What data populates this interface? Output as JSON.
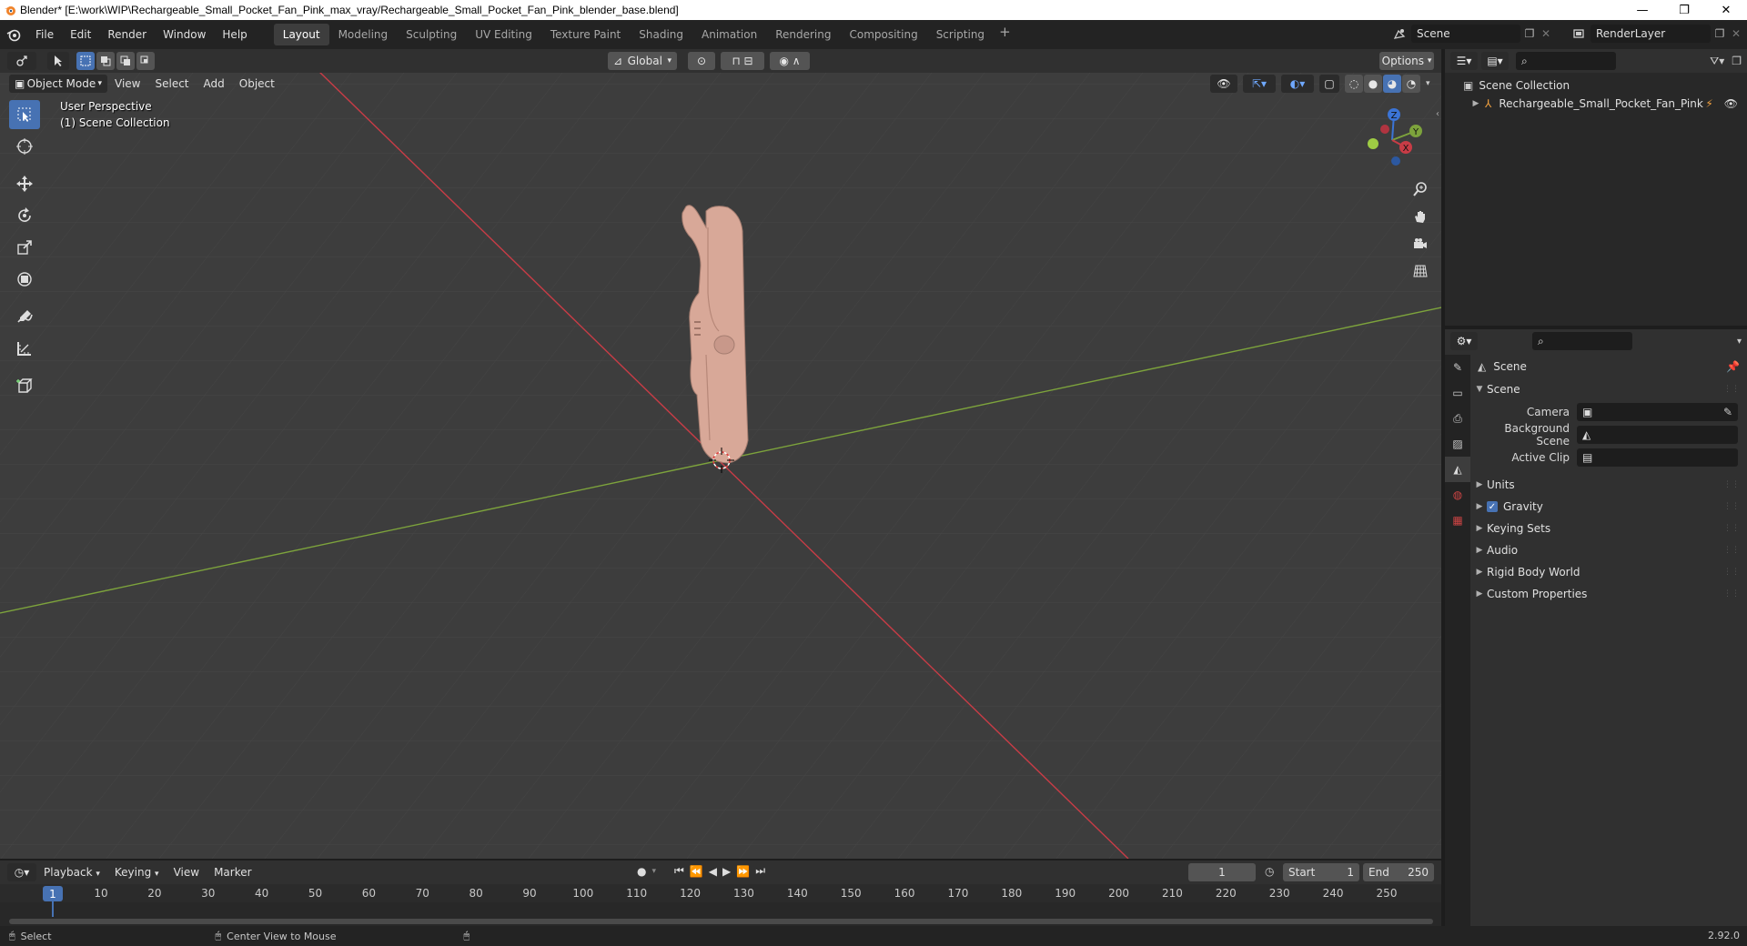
{
  "window": {
    "title": "Blender* [E:\\work\\WIP\\Rechargeable_Small_Pocket_Fan_Pink_max_vray/Rechargeable_Small_Pocket_Fan_Pink_blender_base.blend]",
    "minimize": "—",
    "restore": "❐",
    "close": "✕"
  },
  "menu": [
    "File",
    "Edit",
    "Render",
    "Window",
    "Help"
  ],
  "workspaces": [
    "Layout",
    "Modeling",
    "Sculpting",
    "UV Editing",
    "Texture Paint",
    "Shading",
    "Animation",
    "Rendering",
    "Compositing",
    "Scripting"
  ],
  "active_workspace": "Layout",
  "scene_selector": "Scene",
  "renderlayer_selector": "RenderLayer",
  "viewport": {
    "transform_orientation": "Global",
    "options_label": "Options",
    "mode": "Object Mode",
    "menus": [
      "View",
      "Select",
      "Add",
      "Object"
    ],
    "overlay_line1": "User Perspective",
    "overlay_line2": "(1) Scene Collection",
    "axes": {
      "x": "X",
      "y": "Y",
      "z": "Z"
    }
  },
  "outliner": {
    "root": "Scene Collection",
    "items": [
      {
        "name": "Rechargeable_Small_Pocket_Fan_Pink"
      }
    ]
  },
  "properties": {
    "context_title": "Scene",
    "panel_title": "Scene",
    "fields": [
      {
        "label": "Camera",
        "value": ""
      },
      {
        "label": "Background Scene",
        "value": ""
      },
      {
        "label": "Active Clip",
        "value": ""
      }
    ],
    "subpanels": [
      "Units",
      "Gravity",
      "Keying Sets",
      "Audio",
      "Rigid Body World",
      "Custom Properties"
    ],
    "gravity_checked": true
  },
  "timeline": {
    "menus": [
      "Playback",
      "Keying",
      "View",
      "Marker"
    ],
    "current_frame": "1",
    "start_label": "Start",
    "start_value": "1",
    "end_label": "End",
    "end_value": "250",
    "ticks": [
      "1",
      "10",
      "20",
      "30",
      "40",
      "50",
      "60",
      "70",
      "80",
      "90",
      "100",
      "110",
      "120",
      "130",
      "140",
      "150",
      "160",
      "170",
      "180",
      "190",
      "200",
      "210",
      "220",
      "230",
      "240",
      "250"
    ]
  },
  "statusbar": {
    "select": "Select",
    "center_view": "Center View to Mouse",
    "version": "2.92.0"
  },
  "colors": {
    "accent": "#4772b3",
    "x_axis": "#c83c46",
    "y_axis": "#7da33c",
    "z_axis": "#3b74d6",
    "model": "#d8a898"
  }
}
